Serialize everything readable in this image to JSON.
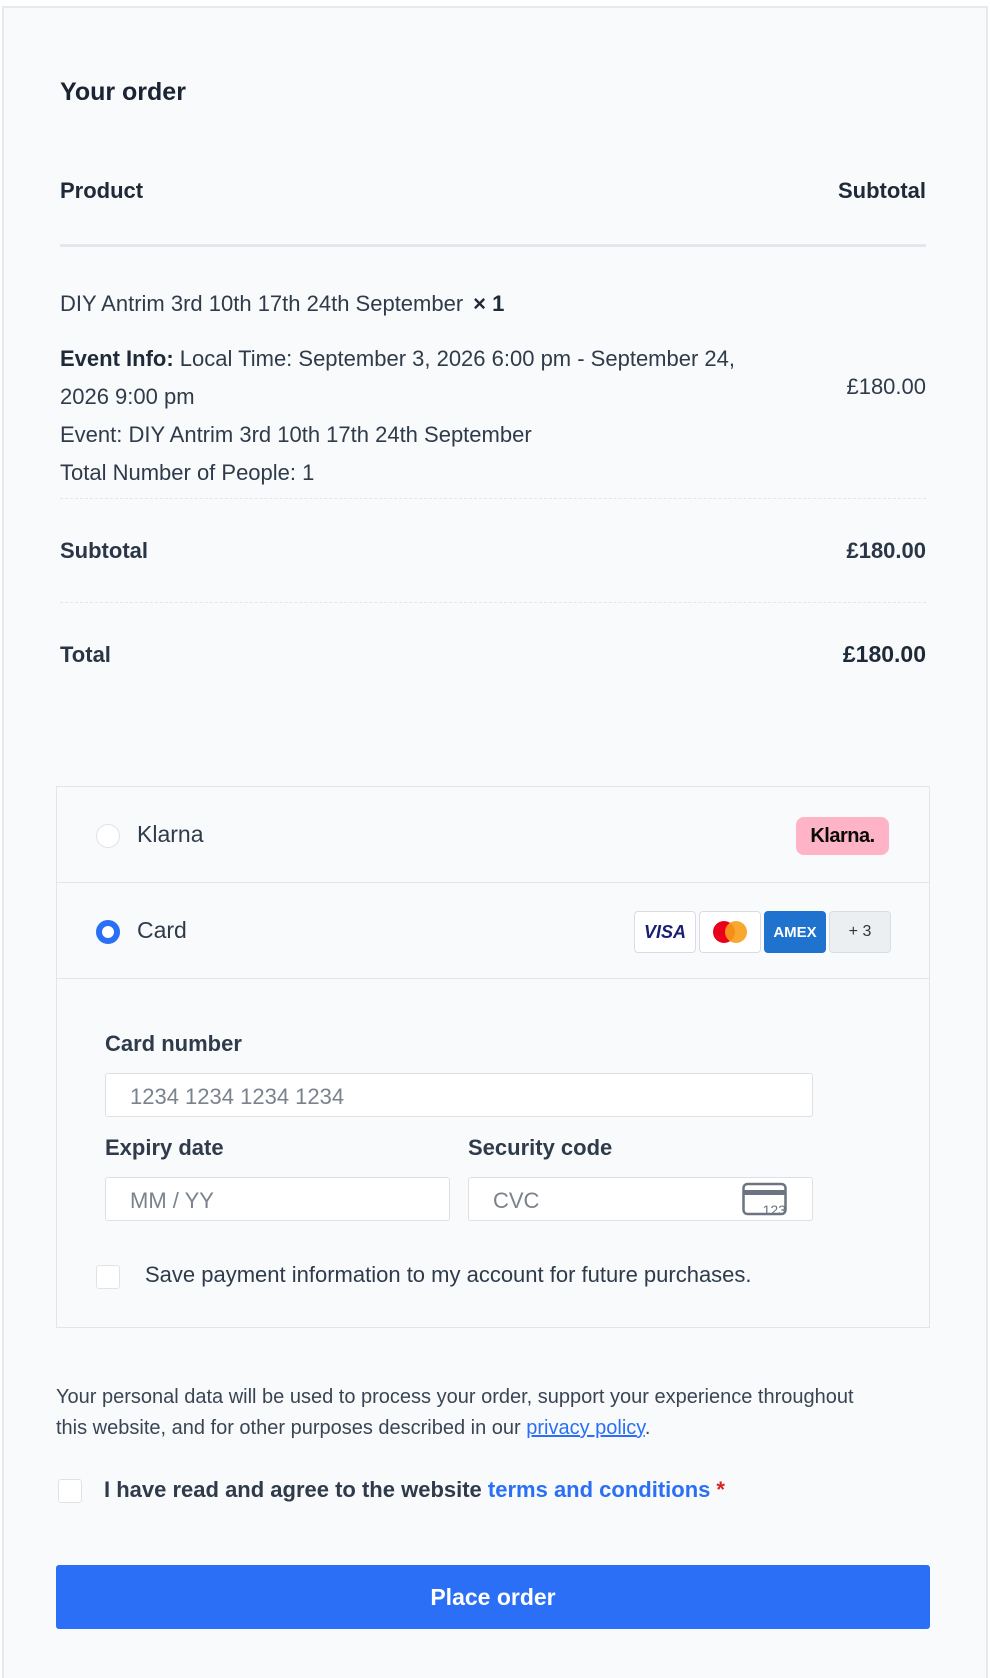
{
  "order": {
    "title": "Your order",
    "header": {
      "product": "Product",
      "subtotal": "Subtotal"
    },
    "item": {
      "name": "DIY Antrim 3rd 10th 17th 24th September",
      "qty": "× 1",
      "meta": {
        "event_info_label": "Event Info:",
        "event_info_value": "Local Time: September 3, 2026 6:00 pm - September 24, 2026 9:00 pm",
        "event": "Event: DIY Antrim 3rd 10th 17th 24th September",
        "people": "Total Number of People: 1"
      },
      "price": "£180.00"
    },
    "subtotal": {
      "label": "Subtotal",
      "value": "£180.00"
    },
    "total": {
      "label": "Total",
      "value": "£180.00"
    }
  },
  "payment": {
    "methods": [
      {
        "label": "Klarna",
        "selected": false,
        "badge": "Klarna."
      },
      {
        "label": "Card",
        "selected": true,
        "brands": [
          "VISA",
          "Mastercard",
          "AMEX",
          "+ 3"
        ]
      }
    ],
    "card": {
      "number_label": "Card number",
      "number_placeholder": "1234 1234 1234 1234",
      "expiry_label": "Expiry date",
      "expiry_placeholder": "MM / YY",
      "cvc_label": "Security code",
      "cvc_placeholder": "CVC",
      "cvc_icon_text": "123",
      "save_label": "Save payment information to my account for future purchases."
    },
    "colors": {
      "accent": "#2a6ff5",
      "klarna_pink": "#ffb3c7",
      "amex_blue": "#1f72cd"
    }
  },
  "privacy": {
    "text": "Your personal data will be used to process your order, support your experience throughout this website, and for other purposes described in our ",
    "link": "privacy policy",
    "end": "."
  },
  "terms": {
    "text": "I have read and agree to the website ",
    "link": "terms and conditions",
    "required": "*"
  },
  "actions": {
    "place_order": "Place order"
  }
}
